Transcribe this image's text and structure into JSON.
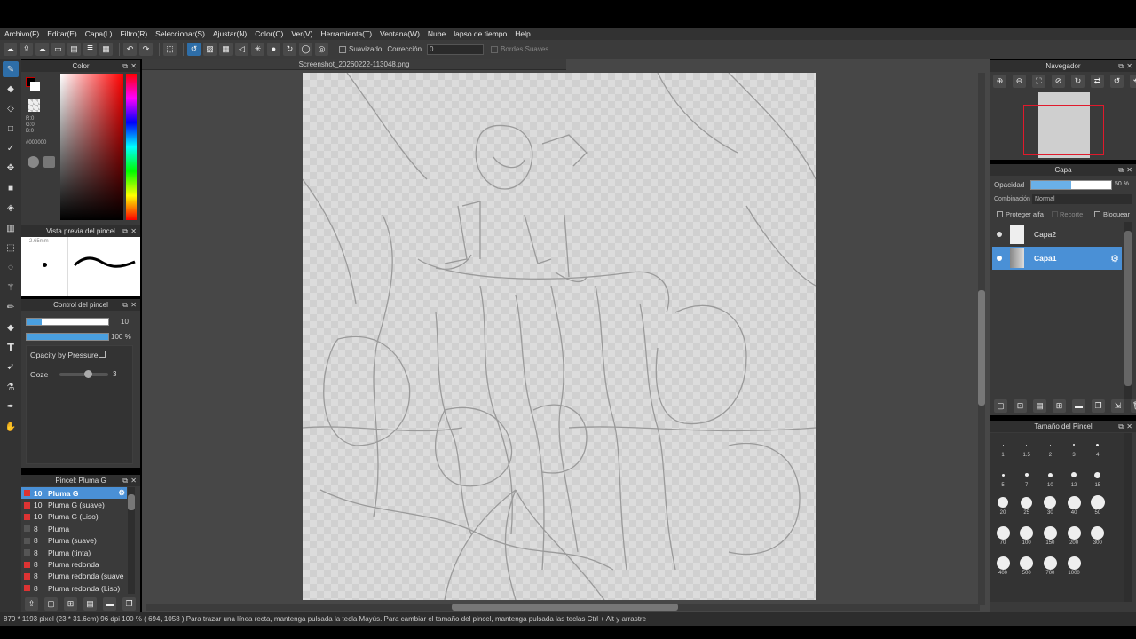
{
  "menu": [
    "Archivo(F)",
    "Editar(E)",
    "Capa(L)",
    "Filtro(R)",
    "Seleccionar(S)",
    "Ajustar(N)",
    "Color(C)",
    "Ver(V)",
    "Herramienta(T)",
    "Ventana(W)",
    "Nube",
    "lapso de tiempo",
    "Help"
  ],
  "toolbar": {
    "smooth_label": "Suavizado",
    "correction_label": "Corrección",
    "correction_value": "0",
    "soft_edges_label": "Bordes Suaves"
  },
  "color_panel": {
    "title": "Color",
    "r": "R:0",
    "g": "G:0",
    "b": "B:0",
    "hex": "#000000"
  },
  "brush_preview": {
    "title": "Vista previa del pincel",
    "size": "2.65mm"
  },
  "brush_control": {
    "title": "Control del pincel",
    "size_value": "10",
    "opacity_value": "100 %",
    "opacity_by_pressure": "Opacity by Pressure",
    "ooze_label": "Ooze",
    "ooze_value": "3"
  },
  "brush_list": {
    "title": "Pincel: Pluma G",
    "items": [
      {
        "size": "10",
        "name": "Pluma G",
        "color": "#d33"
      },
      {
        "size": "10",
        "name": "Pluma G (suave)",
        "color": "#d33"
      },
      {
        "size": "10",
        "name": "Pluma G (Liso)",
        "color": "#d33"
      },
      {
        "size": "8",
        "name": "Pluma",
        "color": "#555"
      },
      {
        "size": "8",
        "name": "Pluma (suave)",
        "color": "#555"
      },
      {
        "size": "8",
        "name": "Pluma (tinta)",
        "color": "#555"
      },
      {
        "size": "8",
        "name": "Pluma redonda",
        "color": "#d33"
      },
      {
        "size": "8",
        "name": "Pluma redonda (suave",
        "color": "#d33"
      },
      {
        "size": "8",
        "name": "Pluma redonda (Liso)",
        "color": "#d33"
      }
    ]
  },
  "document": {
    "tab_title": "Screenshot_20260222-113048.png"
  },
  "navigator": {
    "title": "Navegador"
  },
  "layers": {
    "title": "Capa",
    "opacity_label": "Opacidad",
    "opacity_value": "50 %",
    "blend_label": "Combinación",
    "blend_value": "Normal",
    "protect_alpha": "Proteger alfa",
    "clip": "Recorte",
    "lock": "Bloquear",
    "items": [
      {
        "name": "Capa2"
      },
      {
        "name": "Capa1"
      }
    ]
  },
  "brush_size": {
    "title": "Tamaño del Pincel",
    "sizes": [
      "1",
      "1.5",
      "2",
      "3",
      "4",
      "5",
      "7",
      "10",
      "12",
      "15",
      "20",
      "25",
      "30",
      "40",
      "50",
      "70",
      "100",
      "150",
      "200",
      "300",
      "400",
      "500",
      "700",
      "1000"
    ]
  },
  "status": {
    "text": "870 * 1193 pixel   (23 * 31.6cm)   96 dpi   100 %   ( 694, 1058 )   Para trazar una línea recta, mantenga pulsada la tecla Mayús. Para cambiar el tamaño del pincel, mantenga pulsada las teclas Ctrl + Alt y arrastre"
  }
}
